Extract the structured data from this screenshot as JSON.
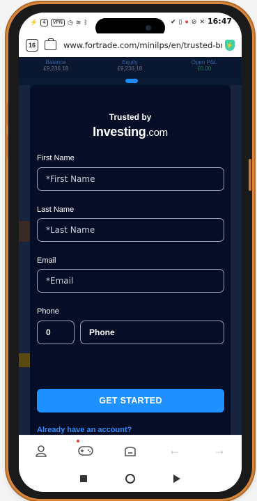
{
  "status_bar": {
    "time": "16:47",
    "left_icons": [
      "flash-icon",
      "4-icon",
      "vpn-icon",
      "clock-icon",
      "wifi-icon",
      "bluetooth-icon"
    ],
    "left_badge_1": "4",
    "left_badge_2": "VPN",
    "right_icons": [
      "check-icon",
      "battery-box-icon",
      "record-icon",
      "alarm-off-icon",
      "x-icon"
    ]
  },
  "browser": {
    "tab_count": "16",
    "url": "www.fortrade.com/minilps/en/trusted-brok"
  },
  "background_stats": [
    {
      "label": "Balance",
      "value": "£9,236.18"
    },
    {
      "label": "Equity",
      "value": "£9,236.18"
    },
    {
      "label": "Open P&L",
      "value": "£0.00"
    }
  ],
  "modal": {
    "trusted_by": "Trusted by",
    "logo_main": "Investing",
    "logo_suffix": ".com",
    "first_name_label": "First Name",
    "first_name_placeholder": "*First Name",
    "last_name_label": "Last Name",
    "last_name_placeholder": "*Last Name",
    "email_label": "Email",
    "email_placeholder": "*Email",
    "phone_label": "Phone",
    "phone_code": "0",
    "phone_placeholder": "Phone",
    "cta_label": "GET STARTED",
    "already_link": "Already have an account?"
  },
  "bottom_nav": {
    "items": [
      "profile-icon",
      "games-icon",
      "tabs-icon",
      "back-icon",
      "forward-icon"
    ]
  },
  "colors": {
    "accent": "#1e90ff",
    "modal_bg": "#050e26",
    "link": "#2b8cff",
    "frame": "#d8863e"
  }
}
